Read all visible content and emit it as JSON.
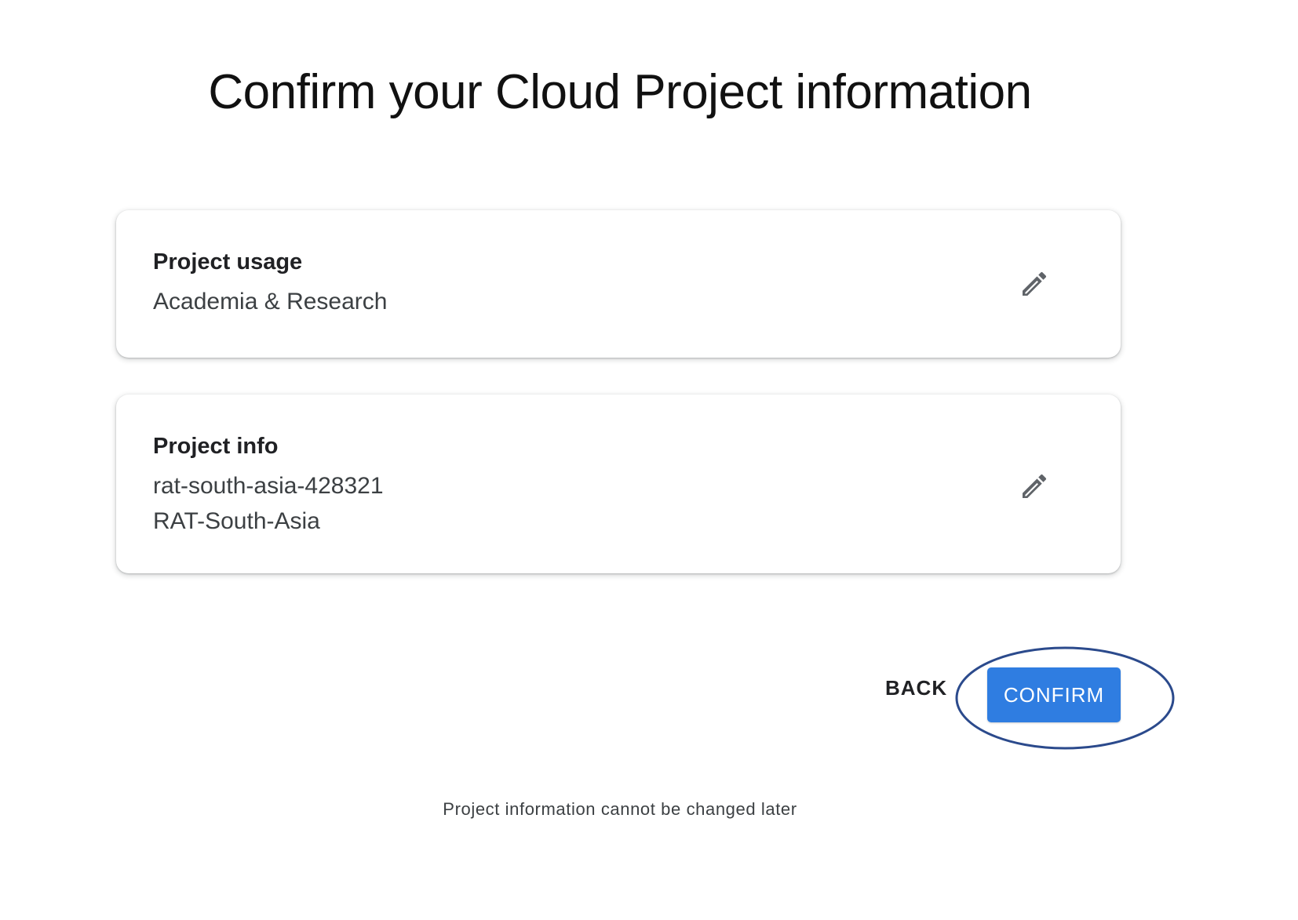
{
  "page": {
    "title": "Confirm your Cloud Project information",
    "footer_note": "Project information cannot be changed later"
  },
  "cards": {
    "usage": {
      "heading": "Project usage",
      "value": "Academia & Research",
      "edit_icon": "pencil-icon"
    },
    "info": {
      "heading": "Project info",
      "project_id": "rat-south-asia-428321",
      "project_name": "RAT-South-Asia",
      "edit_icon": "pencil-icon"
    }
  },
  "actions": {
    "back_label": "BACK",
    "confirm_label": "CONFIRM"
  },
  "colors": {
    "confirm_button": "#2f7de1",
    "highlight_ellipse": "#2b4a8c"
  }
}
